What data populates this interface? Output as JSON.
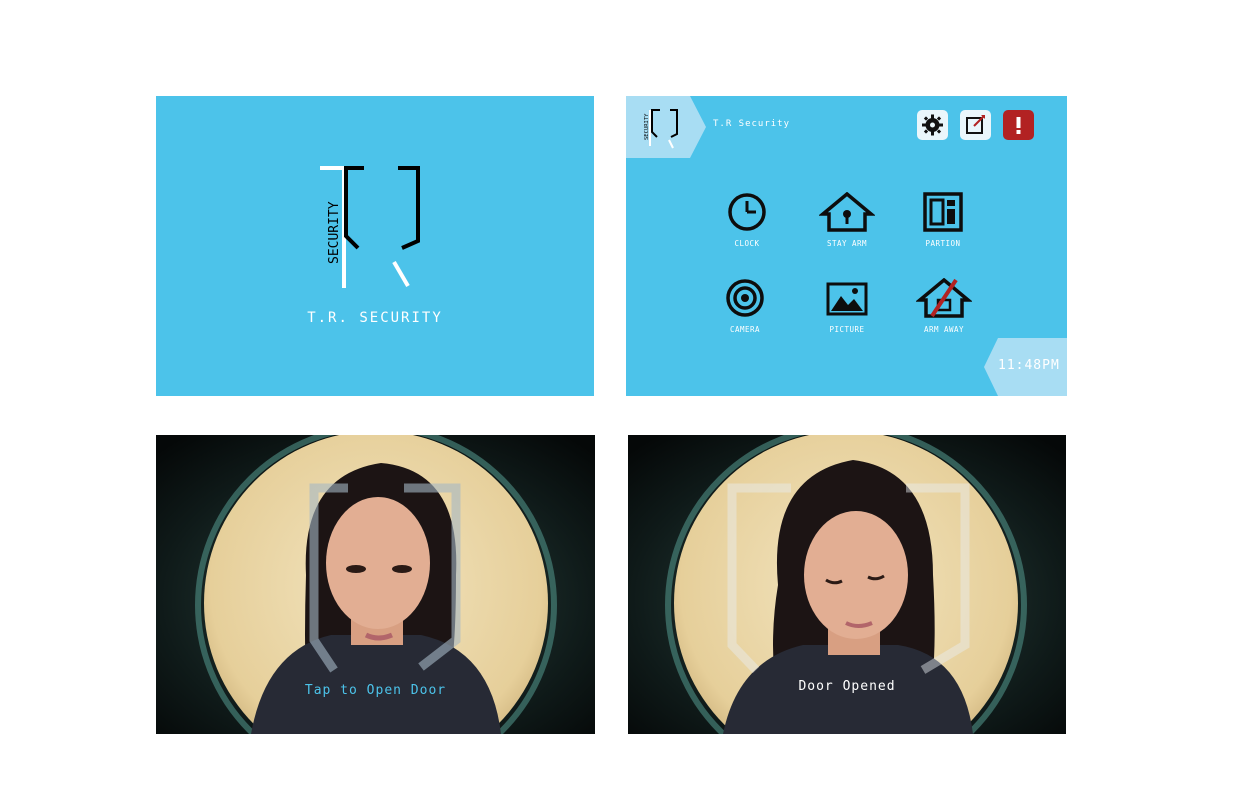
{
  "splash": {
    "logo_text": "SECURITY",
    "brand": "T.R. SECURITY"
  },
  "dashboard": {
    "logo_text": "SECURITY",
    "title": "T.R Security",
    "top_buttons": [
      {
        "name": "settings",
        "icon": "gear-icon"
      },
      {
        "name": "edit",
        "icon": "edit-icon"
      },
      {
        "name": "alert",
        "icon": "alert-icon"
      }
    ],
    "grid": [
      {
        "label": "CLOCK",
        "icon": "clock-icon"
      },
      {
        "label": "STAY ARM",
        "icon": "house-lock-icon"
      },
      {
        "label": "PARTION",
        "icon": "partition-icon"
      },
      {
        "label": "CAMERA",
        "icon": "camera-icon"
      },
      {
        "label": "PICTURE",
        "icon": "picture-icon"
      },
      {
        "label": "ARM AWAY",
        "icon": "house-away-icon"
      }
    ],
    "time": "11:48PM"
  },
  "camera_locked": {
    "caption": "Tap to Open Door"
  },
  "camera_opened": {
    "caption": "Door Opened"
  },
  "colors": {
    "primary_blue": "#4cc3ea",
    "light_blue": "#a8ddf3",
    "alert_red": "#b22222",
    "icon_dark": "#0d0d0d"
  }
}
